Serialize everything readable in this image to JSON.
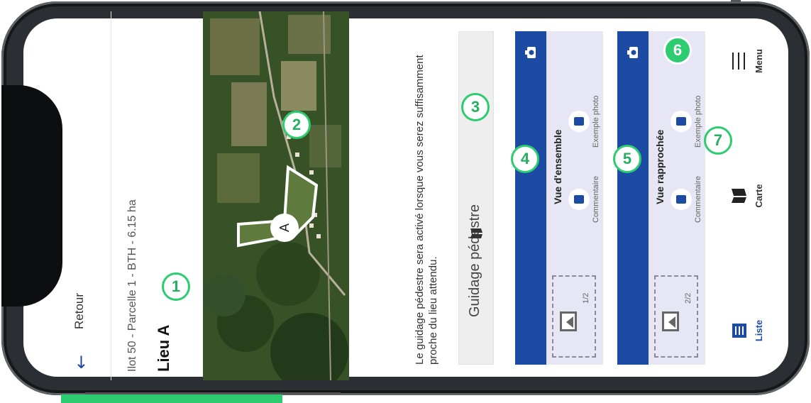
{
  "nav": {
    "back_label": "Retour"
  },
  "header": {
    "subtitle": "Ilot 50 - Parcelle 1 - BTH - 6.15 ha",
    "title": "Lieu A"
  },
  "map": {
    "marker_label": "A"
  },
  "guidance": {
    "text": "Le guidage pédestre sera activé lorsque vous serez suffisamment proche du lieu attendu.",
    "button_label": "Guidage pédestre"
  },
  "cards": [
    {
      "title": "Vue d'ensemble",
      "counter": "1/2",
      "comment_label": "Commentaire",
      "example_label": "Exemple photo"
    },
    {
      "title": "Vue rapprochée",
      "counter": "2/2",
      "comment_label": "Commentaire",
      "example_label": "Exemple photo"
    }
  ],
  "tabbar": {
    "items": [
      {
        "label": "Liste",
        "icon": "list-icon"
      },
      {
        "label": "Carte",
        "icon": "map-icon"
      },
      {
        "label": "Menu",
        "icon": "menu-icon"
      }
    ]
  },
  "annotations": [
    "1",
    "2",
    "3",
    "4",
    "5",
    "6",
    "7"
  ],
  "colors": {
    "accent": "#1d4aa3",
    "annotation": "#2ecc71",
    "card_bg": "#e6e6f4"
  }
}
